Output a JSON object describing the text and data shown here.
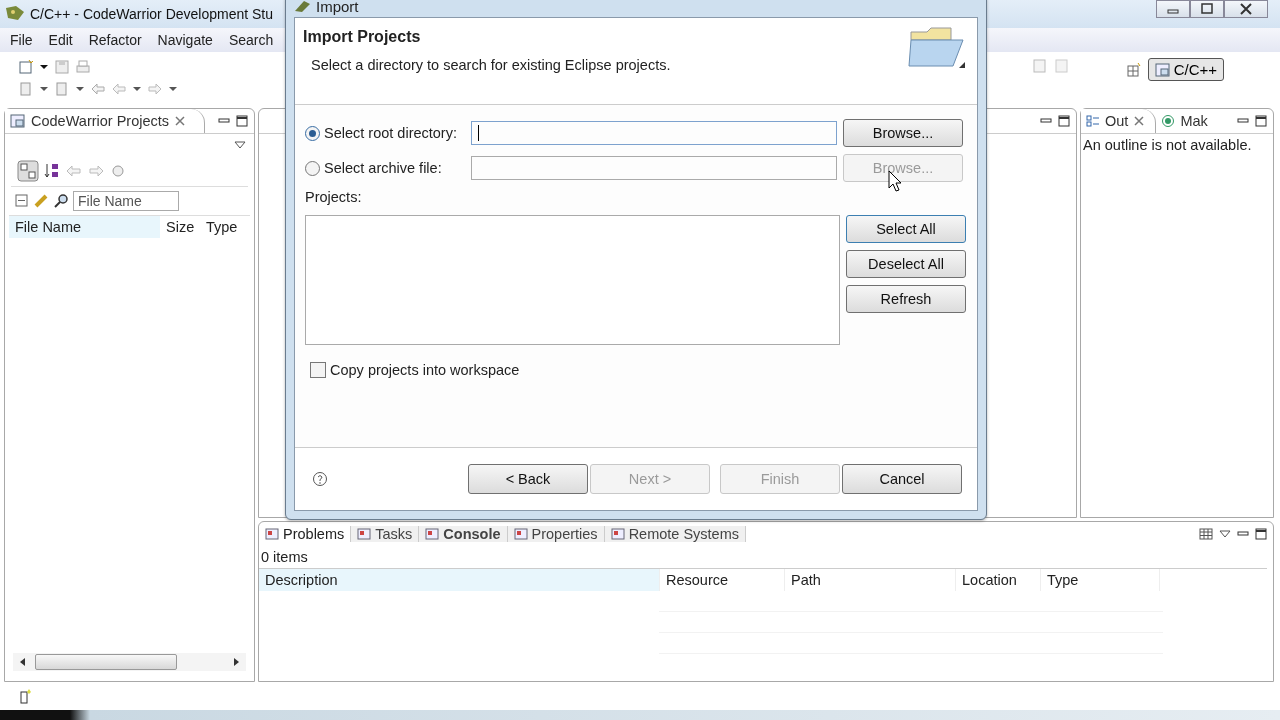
{
  "window": {
    "title": "C/C++ - CodeWarrior Development Stu"
  },
  "menu": [
    "File",
    "Edit",
    "Refactor",
    "Navigate",
    "Search"
  ],
  "perspective": {
    "label": "C/C++",
    "selected": true
  },
  "projects_panel": {
    "tab": "CodeWarrior Projects",
    "filter": {
      "placeholder": "File Name"
    },
    "columns": [
      "File Name",
      "Size",
      "Type"
    ]
  },
  "outline_panel": {
    "tabs": [
      {
        "label": "Out",
        "selected": true
      },
      {
        "label": "Mak",
        "selected": false
      }
    ],
    "message": "An outline is not available."
  },
  "problems_panel": {
    "tabs": [
      {
        "label": "Problems",
        "selected": true,
        "bold": false
      },
      {
        "label": "Tasks",
        "selected": false,
        "bold": false
      },
      {
        "label": "Console",
        "selected": false,
        "bold": true
      },
      {
        "label": "Properties",
        "selected": false,
        "bold": false
      },
      {
        "label": "Remote Systems",
        "selected": false,
        "bold": false
      }
    ],
    "count": "0 items",
    "columns": [
      "Description",
      "Resource",
      "Path",
      "Location",
      "Type"
    ]
  },
  "dialog": {
    "title": "Import",
    "heading": "Import Projects",
    "description": "Select a directory to search for existing Eclipse projects.",
    "sources": [
      {
        "label": "Select root directory:",
        "selected": true,
        "focused": true,
        "browse": {
          "label": "Browse...",
          "disabled": false
        }
      },
      {
        "label": "Select archive file:",
        "selected": false,
        "focused": false,
        "browse": {
          "label": "Browse...",
          "disabled": true
        }
      }
    ],
    "projects_label": "Projects:",
    "list_buttons": [
      "Select All",
      "Deselect All",
      "Refresh"
    ],
    "copy": {
      "label": "Copy projects into workspace",
      "checked": false
    },
    "buttons": [
      {
        "label": "< Back",
        "disabled": false
      },
      {
        "label": "Next >",
        "disabled": true
      },
      {
        "label": "Finish",
        "disabled": true
      },
      {
        "label": "Cancel",
        "disabled": false
      }
    ]
  }
}
